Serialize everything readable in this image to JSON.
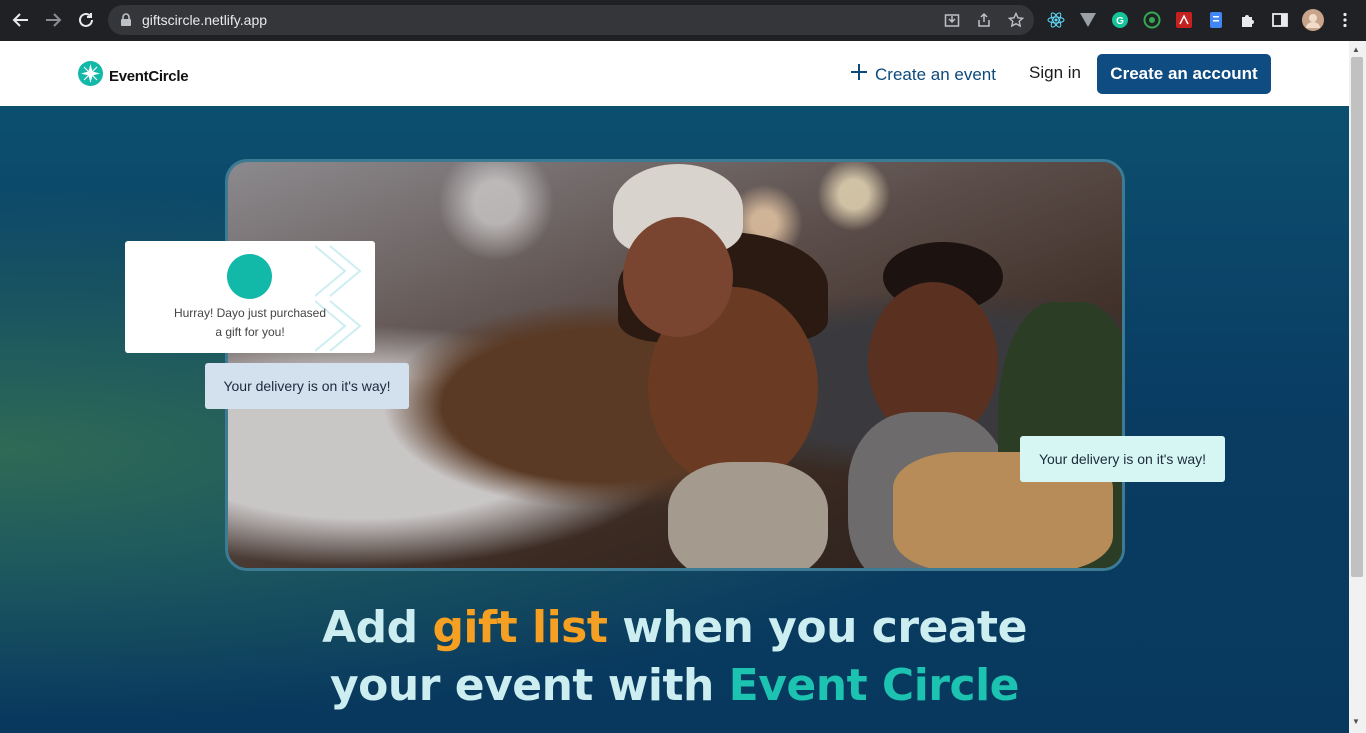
{
  "browser": {
    "url": "giftscircle.netlify.app",
    "icons": [
      "back-icon",
      "forward-icon",
      "reload-icon",
      "lock-icon",
      "install-icon",
      "share-icon",
      "bookmark-star-icon",
      "react-devtools-icon",
      "vue-devtools-icon",
      "grammarly-icon",
      "extension-icon",
      "pdf-icon",
      "docs-icon",
      "puzzle-icon",
      "sidepanel-icon",
      "profile-avatar-icon",
      "menu-icon"
    ]
  },
  "header": {
    "logo_text": "EventCircle",
    "create_event_label": "Create an event",
    "sign_in_label": "Sign in",
    "create_account_label": "Create an account"
  },
  "hero": {
    "card_message_line1": "Hurray! Dayo just purchased",
    "card_message_line2": "a gift for you!",
    "bubble1_text": "Your delivery is on it's way!",
    "bubble2_text": "Your delivery is on it's way!",
    "headline": {
      "part1": "Add ",
      "highlight1": "gift list",
      "part2": " when you create",
      "part3": "your event with ",
      "highlight2": "Event Circle"
    }
  },
  "colors": {
    "brand_teal": "#12b8a8",
    "button_blue": "#0f4c81",
    "highlight_orange": "#f5a023",
    "highlight_teal": "#1cc3b0"
  }
}
